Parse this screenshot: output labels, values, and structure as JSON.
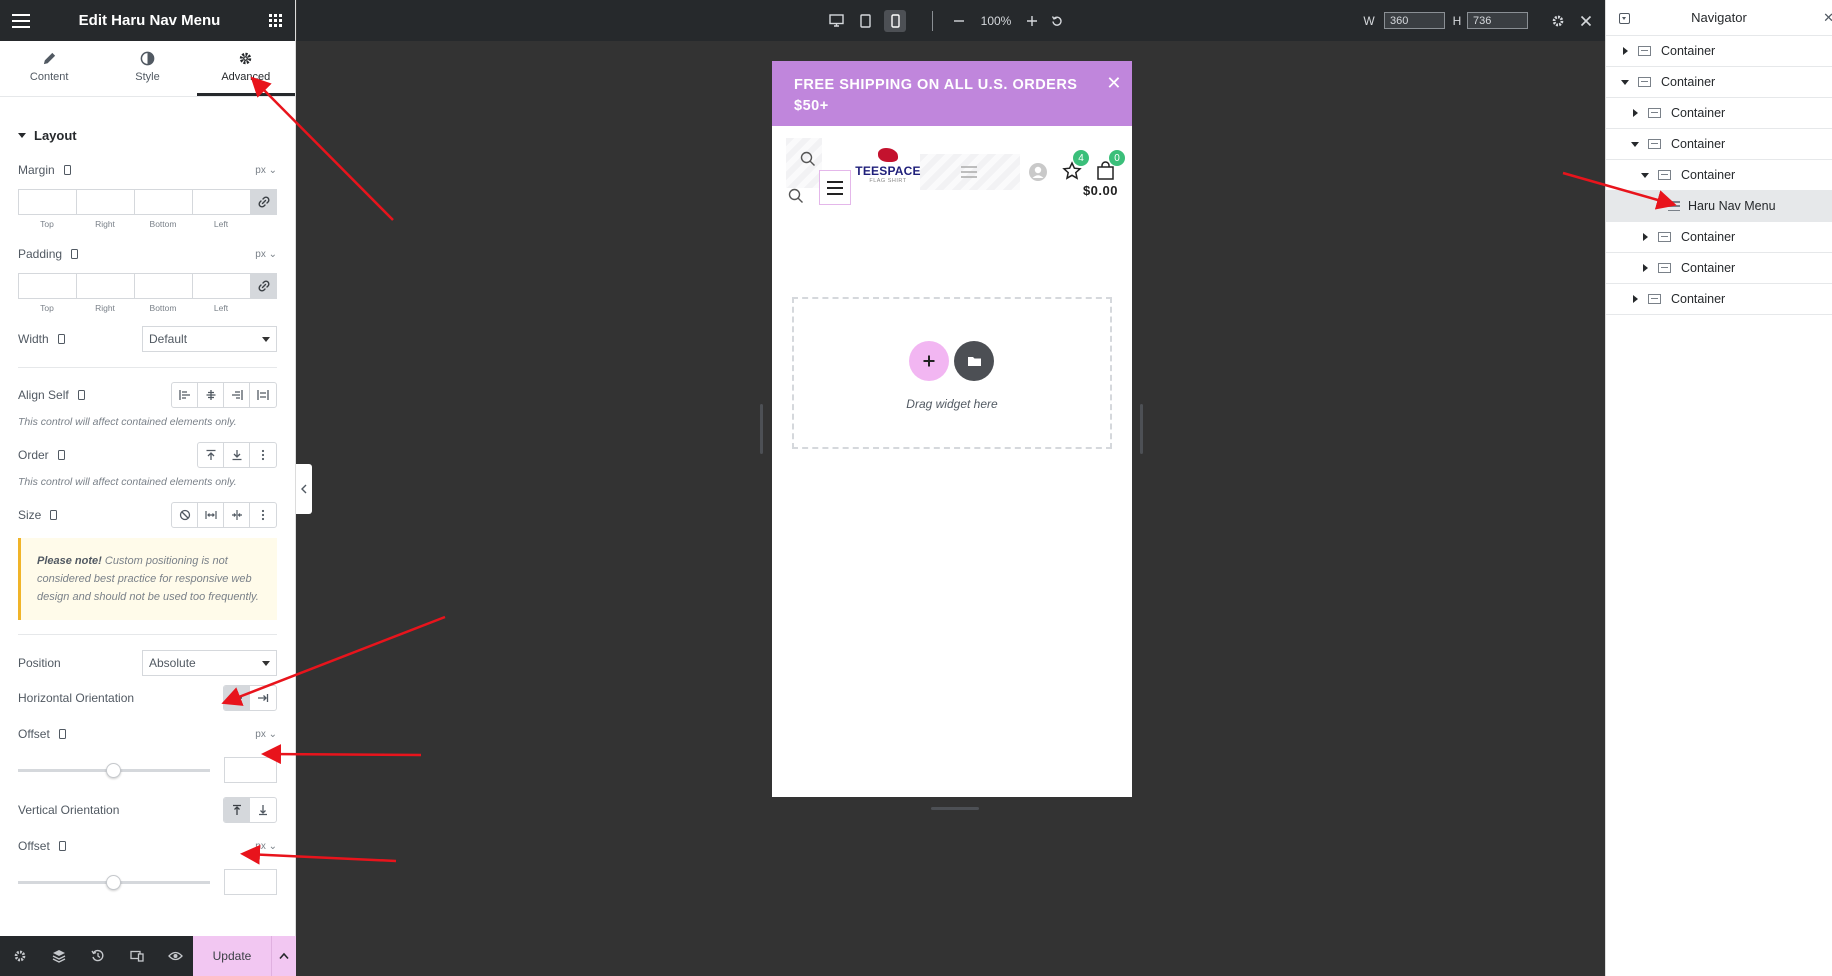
{
  "panel": {
    "title": "Edit Haru Nav Menu",
    "tabs": [
      {
        "label": "Content"
      },
      {
        "label": "Style"
      },
      {
        "label": "Advanced"
      }
    ],
    "section_title": "Layout",
    "margin": {
      "label": "Margin",
      "unit": "px",
      "top": "",
      "right": "",
      "bottom": "",
      "left": ""
    },
    "padding": {
      "label": "Padding",
      "unit": "px",
      "top": "",
      "right": "",
      "bottom": "",
      "left": ""
    },
    "dim_labels": {
      "top": "Top",
      "right": "Right",
      "bottom": "Bottom",
      "left": "Left"
    },
    "width": {
      "label": "Width",
      "value": "Default"
    },
    "align_self": {
      "label": "Align Self",
      "hint": "This control will affect contained elements only."
    },
    "order": {
      "label": "Order",
      "hint": "This control will affect contained elements only."
    },
    "size": {
      "label": "Size"
    },
    "note": {
      "bold": "Please note!",
      "text": " Custom positioning is not considered best practice for responsive web design and should not be used too frequently."
    },
    "position": {
      "label": "Position",
      "value": "Absolute"
    },
    "horizontal_orientation": {
      "label": "Horizontal Orientation"
    },
    "offset_h": {
      "label": "Offset",
      "unit": "px",
      "value": ""
    },
    "vertical_orientation": {
      "label": "Vertical Orientation"
    },
    "offset_v": {
      "label": "Offset",
      "unit": "px",
      "value": ""
    },
    "update_label": "Update"
  },
  "toolbar": {
    "zoom": "100%",
    "width_label": "W",
    "width_value": "360",
    "height_label": "H",
    "height_value": "736"
  },
  "preview": {
    "promo_text": "FREE SHIPPING ON ALL U.S. ORDERS $50+",
    "logo_name": "TEESPACE",
    "logo_sub": "FLAG SHIRT",
    "wishlist_count": "4",
    "cart_count": "0",
    "cart_total": "$0.00",
    "drop_text": "Drag widget here"
  },
  "navigator": {
    "title": "Navigator",
    "items": [
      {
        "label": "Container",
        "depth": 0,
        "toggle": "collapsed",
        "kind": "container"
      },
      {
        "label": "Container",
        "depth": 0,
        "toggle": "expanded",
        "kind": "container"
      },
      {
        "label": "Container",
        "depth": 1,
        "toggle": "collapsed",
        "kind": "container"
      },
      {
        "label": "Container",
        "depth": 1,
        "toggle": "expanded",
        "kind": "container"
      },
      {
        "label": "Container",
        "depth": 2,
        "toggle": "expanded",
        "kind": "container"
      },
      {
        "label": "Haru Nav Menu",
        "depth": 3,
        "toggle": "none",
        "kind": "widget",
        "selected": true
      },
      {
        "label": "Container",
        "depth": 2,
        "toggle": "collapsed",
        "kind": "container"
      },
      {
        "label": "Container",
        "depth": 2,
        "toggle": "collapsed",
        "kind": "container"
      },
      {
        "label": "Container",
        "depth": 1,
        "toggle": "collapsed",
        "kind": "container"
      }
    ]
  },
  "colors": {
    "panel_dark": "#26292c",
    "canvas_bg": "#333333",
    "promo_bg": "#c086dc",
    "accent_pink": "#f2c7f2",
    "annotation_red": "#e8141c",
    "badge_green": "#3bbf7a"
  }
}
